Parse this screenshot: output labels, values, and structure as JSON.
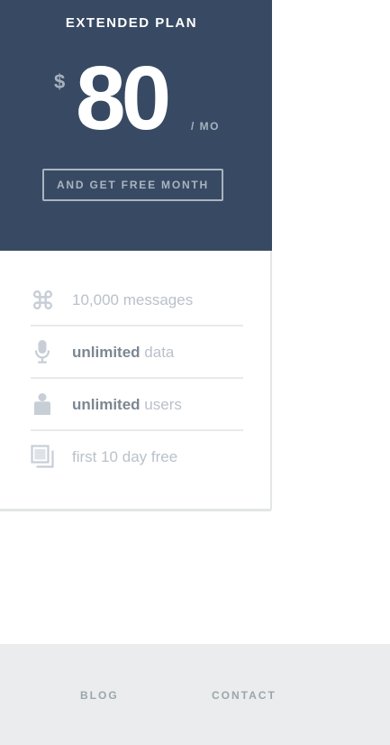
{
  "plan": {
    "title": "EXTENDED PLAN",
    "currency": "$",
    "price": "80",
    "period": "/ MO",
    "cta_label": "AND GET FREE MONTH"
  },
  "features": [
    {
      "icon": "command-icon",
      "strong": "",
      "text": "10,000 messages"
    },
    {
      "icon": "microphone-icon",
      "strong": "unlimited",
      "text": " data"
    },
    {
      "icon": "user-icon",
      "strong": "unlimited",
      "text": " users"
    },
    {
      "icon": "windows-stack-icon",
      "strong": "",
      "text": "first 10 day free"
    }
  ],
  "footer": {
    "links": [
      {
        "label": "BLOG"
      },
      {
        "label": "CONTACT"
      }
    ]
  },
  "colors": {
    "header_bg": "#384a63",
    "footer_bg": "#ebeced",
    "muted_text": "#b9c1ca",
    "strong_text": "#7c8792"
  }
}
